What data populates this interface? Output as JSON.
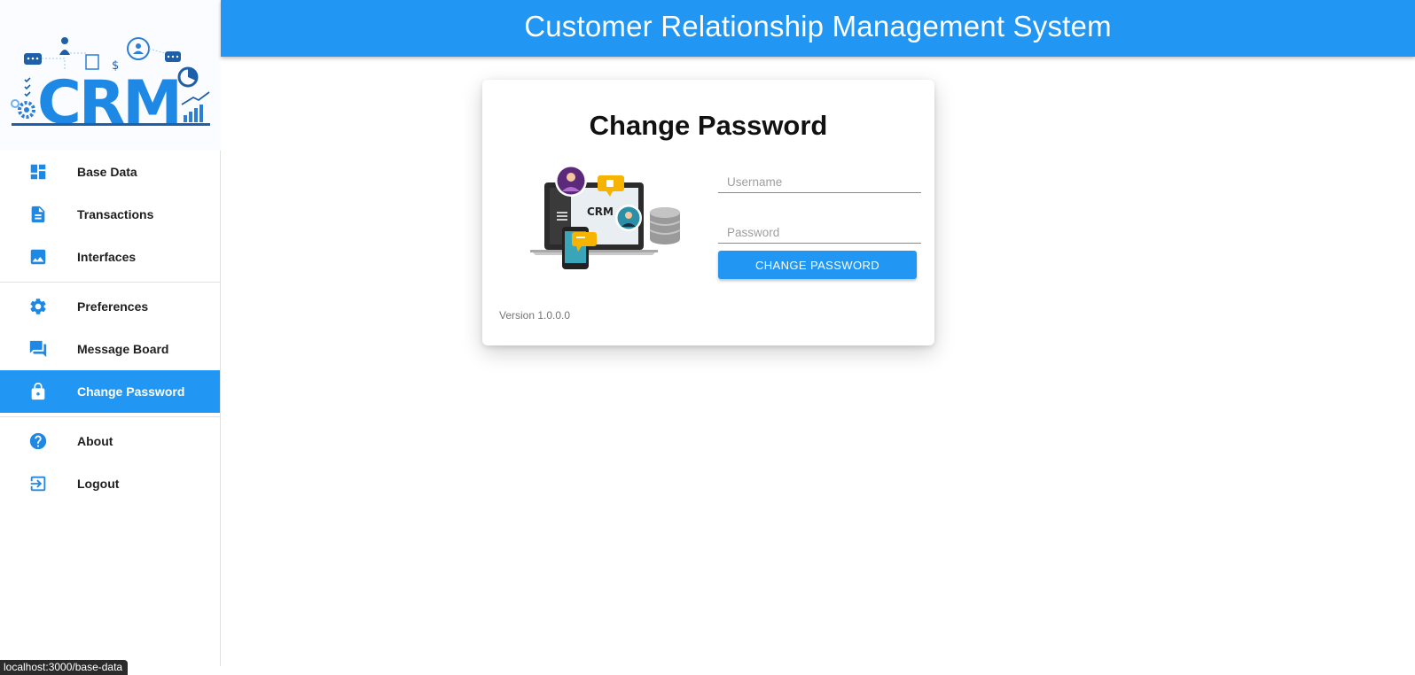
{
  "app": {
    "title": "Customer Relationship Management System",
    "logo_text": "CRM"
  },
  "sidebar": {
    "groups": [
      [
        {
          "label": "Base Data",
          "icon": "dashboard-icon"
        },
        {
          "label": "Transactions",
          "icon": "document-icon"
        },
        {
          "label": "Interfaces",
          "icon": "image-icon"
        }
      ],
      [
        {
          "label": "Preferences",
          "icon": "gear-icon"
        },
        {
          "label": "Message Board",
          "icon": "chat-icon"
        },
        {
          "label": "Change Password",
          "icon": "lock-icon",
          "active": true
        }
      ],
      [
        {
          "label": "About",
          "icon": "help-icon"
        },
        {
          "label": "Logout",
          "icon": "logout-icon"
        }
      ]
    ]
  },
  "card": {
    "title": "Change Password",
    "illustration_text": "CRM",
    "username_placeholder": "Username",
    "password_placeholder": "Password",
    "submit_label": "CHANGE PASSWORD",
    "version": "Version 1.0.0.0"
  },
  "status_bar": {
    "url": "localhost:3000/base-data"
  },
  "colors": {
    "primary": "#2196f3",
    "sidebar_icon": "#1e88e5",
    "text": "#212121"
  }
}
